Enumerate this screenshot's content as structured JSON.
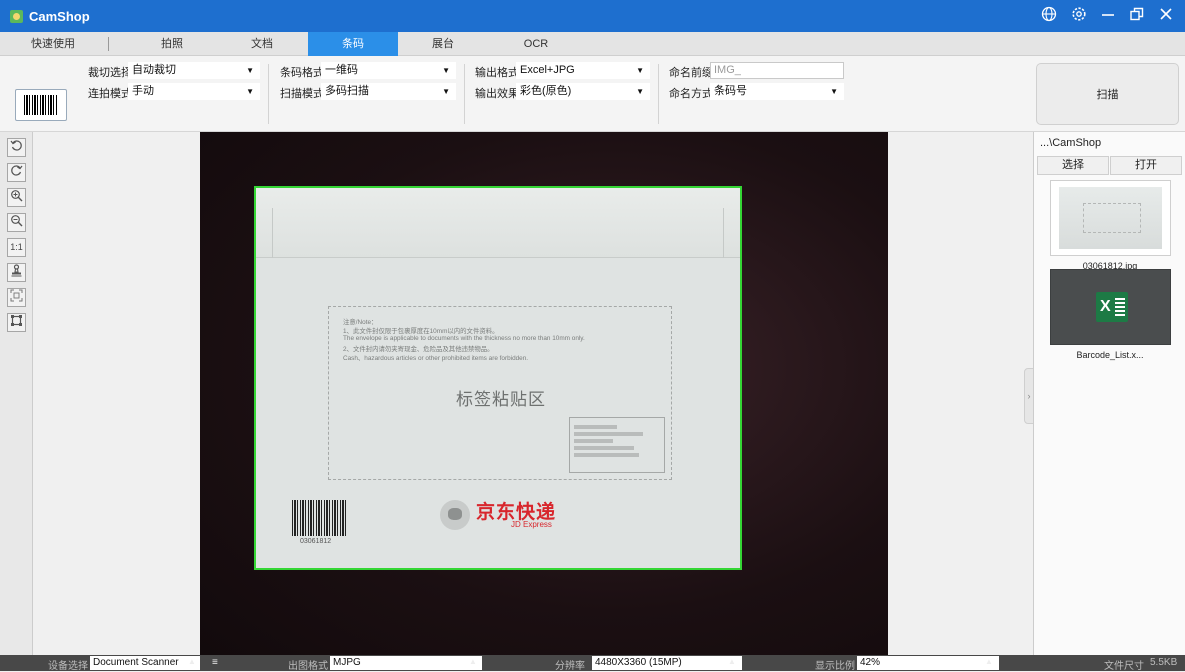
{
  "app": {
    "title": "CamShop"
  },
  "window_icons": [
    "globe-icon",
    "settings-icon",
    "minimize-icon",
    "restore-icon",
    "close-icon"
  ],
  "tabs": [
    {
      "label": "快速使用",
      "active": false
    },
    {
      "label": "拍照",
      "active": false
    },
    {
      "label": "文档",
      "active": false
    },
    {
      "label": "条码",
      "active": true
    },
    {
      "label": "展台",
      "active": false
    },
    {
      "label": "OCR",
      "active": false
    }
  ],
  "toolbar": {
    "crop_label": "裁切选择",
    "crop_value": "自动裁切",
    "shoot_mode_label": "连拍模式",
    "shoot_mode_value": "手动",
    "barcode_format_label": "条码格式",
    "barcode_format_value": "一维码",
    "scan_mode_label": "扫描模式",
    "scan_mode_value": "多码扫描",
    "output_format_label": "输出格式",
    "output_format_value": "Excel+JPG",
    "output_effect_label": "输出效果",
    "output_effect_value": "彩色(原色)",
    "name_prefix_label": "命名前缀",
    "name_prefix_placeholder": "IMG_",
    "naming_label": "命名方式",
    "naming_value": "条码号",
    "scan_button": "扫描"
  },
  "left_tools": [
    "rotate-left-icon",
    "rotate-right-icon",
    "zoom-in-icon",
    "zoom-out-icon",
    "actual-size-icon",
    "stamp-icon",
    "fit-icon",
    "crop-icon"
  ],
  "left_tools_text": {
    "actual_size": "1:1"
  },
  "document": {
    "note_lines": [
      "注意/Note：",
      "1、此文件封仅限于包裹厚度在10mm以内的文件资料。",
      "The envelope is applicable to documents with the thickness no more than 10mm only.",
      "2、文件封内请勿夹寄现金、危险品及其他违禁物品。",
      "Cash、hazardous articles or other prohibited items are forbidden."
    ],
    "label_title": "标签粘贴区",
    "barcode_number": "03061812",
    "logo_cn": "京东快递",
    "logo_en": "JD Express"
  },
  "right_panel": {
    "path": "...\\CamShop",
    "select_button": "选择",
    "open_button": "打开",
    "files": [
      {
        "name": "03061812.jpg",
        "type": "image"
      },
      {
        "name": "Barcode_List.x...",
        "type": "excel"
      }
    ],
    "excel_letter": "X"
  },
  "status_bar": {
    "device_label": "设备选择",
    "device_value": "Document Scanner",
    "output_format_label": "出图格式",
    "output_format_value": "MJPG",
    "resolution_label": "分辨率",
    "resolution_value": "4480X3360 (15MP)",
    "scale_label": "显示比例",
    "scale_value": "42%",
    "file_size_label": "文件尺寸",
    "file_size_value": "5.5KB"
  }
}
